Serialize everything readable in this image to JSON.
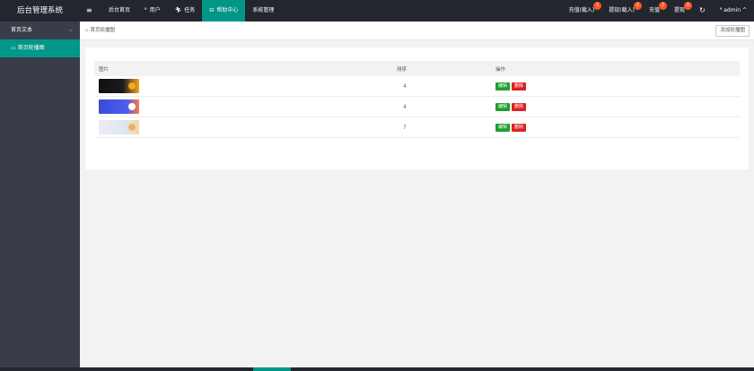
{
  "app": {
    "title": "后台管理系统"
  },
  "topnav": {
    "menu_icon": "hamburger-icon",
    "items": [
      {
        "label": "后台首页",
        "icon": ""
      },
      {
        "label": "用户",
        "icon": "user-icon"
      },
      {
        "label": "任务",
        "icon": "run-icon"
      },
      {
        "label": "帮助中心",
        "icon": "monitor-icon",
        "active": true
      },
      {
        "label": "系统管理",
        "icon": ""
      }
    ]
  },
  "rightnav": {
    "items": [
      {
        "label": "充值(载入)",
        "badge": "1"
      },
      {
        "label": "提现(载入)",
        "badge": "2"
      },
      {
        "label": "充值",
        "badge": "2"
      },
      {
        "label": "提现",
        "badge": "0"
      }
    ],
    "refresh_icon": "refresh-icon",
    "user": "admin",
    "user_icon": "user-icon",
    "caret_icon": "caret-up-icon"
  },
  "sidebar": {
    "group_label": "首页文本",
    "item_label": "首页轮播图"
  },
  "breadcrumb": {
    "text": "首页轮播图"
  },
  "add_button": "添加轮播图",
  "table": {
    "headers": [
      "图片",
      "排序",
      "操作"
    ],
    "rows": [
      {
        "sort": "4",
        "buttons": [
          "编辑",
          "删除"
        ]
      },
      {
        "sort": "4",
        "buttons": [
          "编辑",
          "删除"
        ]
      },
      {
        "sort": "7",
        "buttons": [
          "编辑",
          "删除"
        ]
      }
    ]
  },
  "colors": {
    "accent": "#009688",
    "topbar": "#23262e",
    "sidebar": "#393d49",
    "badge": "#ff5722",
    "edit": "#1e9f31",
    "delete": "#e02020"
  }
}
